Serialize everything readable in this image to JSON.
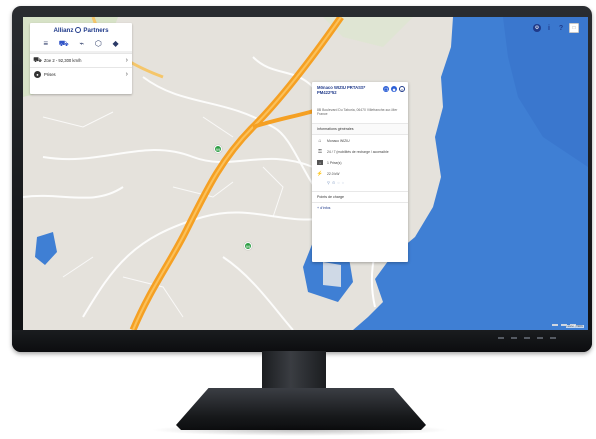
{
  "app": {
    "brand_name": "Allianz",
    "brand_suffix": "Partners",
    "mode_tabs": [
      {
        "icon": "menu-icon",
        "glyph": "≡"
      },
      {
        "icon": "car-icon",
        "glyph": "⛟"
      },
      {
        "icon": "charging-plug-icon",
        "glyph": "⌁"
      },
      {
        "icon": "shield-icon",
        "glyph": "⬡"
      },
      {
        "icon": "directions-icon",
        "glyph": "◆"
      }
    ],
    "vehicle_row": {
      "icon": "vehicle-icon",
      "label": "Zoe 2 - 92,300 km/h"
    },
    "plug_row": {
      "icon": "plug-icon",
      "label": "Prises"
    }
  },
  "top_controls": [
    {
      "icon": "settings-icon",
      "glyph": "⚙"
    },
    {
      "icon": "info-icon",
      "glyph": "i"
    },
    {
      "icon": "help-icon",
      "glyph": "?"
    },
    {
      "icon": "expand-icon",
      "glyph": "□"
    }
  ],
  "popup": {
    "title": "Mönaco WIZIU PRTASS* PM422*52",
    "address": "8B Boulevard Du Taboria, 06470 Villefranche-sur-Mer France",
    "section_title": "Informations générales",
    "rows": [
      {
        "icon": "operator-icon",
        "text": "Monaco WIZIU"
      },
      {
        "icon": "access-icon",
        "text": "24 / 7 (mobilités de recharge / accessible"
      },
      {
        "icon": "payment-icon",
        "text": "1 Prise(s)"
      },
      {
        "icon": "power-icon",
        "text": "22.0 kW"
      }
    ],
    "services": [
      "⚲",
      "⊙",
      "◌",
      "◌"
    ],
    "charge_points_title": "Points de charge",
    "more_label": "+ d'infos"
  },
  "markers": [
    {
      "name": "map-marker-1",
      "label": "99"
    },
    {
      "name": "map-marker-2",
      "label": "99"
    },
    {
      "name": "map-marker-3",
      "label": "99"
    }
  ],
  "attribution": "Leaflet | HERE",
  "colors": {
    "brand_blue": "#1f3a8a",
    "accent_blue": "#2c5fd6",
    "marker_green": "#2e9e45",
    "road_orange": "#f5a023",
    "sea_blue": "#3f7fd4",
    "land": "#e8e6e1"
  }
}
